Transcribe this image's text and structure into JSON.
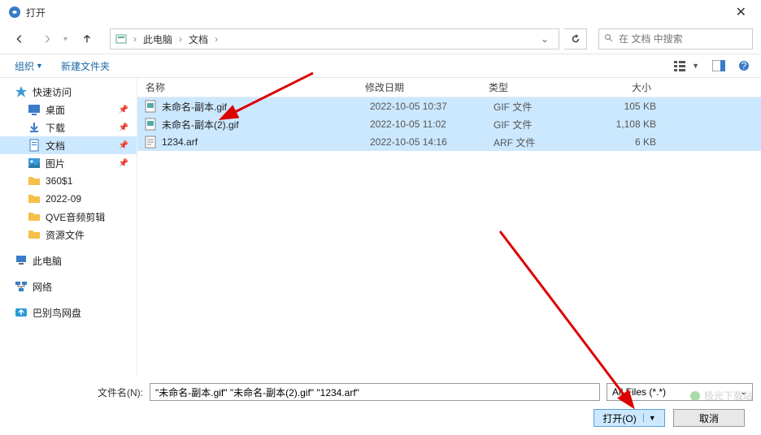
{
  "window": {
    "title": "打开"
  },
  "breadcrumbs": {
    "seg1": "此电脑",
    "seg2": "文档"
  },
  "search": {
    "placeholder": "在 文档 中搜索"
  },
  "toolbar": {
    "organize": "组织",
    "new_folder": "新建文件夹"
  },
  "sidebar": {
    "quick_access": "快速访问",
    "desktop": "桌面",
    "downloads": "下载",
    "documents": "文档",
    "pictures": "图片",
    "f1": "360$1",
    "f2": "2022-09",
    "f3": "QVE音频剪辑",
    "f4": "资源文件",
    "this_pc": "此电脑",
    "network": "网络",
    "babel": "巴别鸟网盘"
  },
  "columns": {
    "name": "名称",
    "date": "修改日期",
    "type": "类型",
    "size": "大小"
  },
  "files": [
    {
      "name": "未命名-副本.gif",
      "date": "2022-10-05 10:37",
      "type": "GIF 文件",
      "size": "105 KB"
    },
    {
      "name": "未命名-副本(2).gif",
      "date": "2022-10-05 11:02",
      "type": "GIF 文件",
      "size": "1,108 KB"
    },
    {
      "name": "1234.arf",
      "date": "2022-10-05 14:16",
      "type": "ARF 文件",
      "size": "6 KB"
    }
  ],
  "footer": {
    "filename_label": "文件名(N):",
    "filename_value": "\"未命名-副本.gif\" \"未命名-副本(2).gif\" \"1234.arf\"",
    "filter": "All Files (*.*)",
    "open": "打开(O)",
    "cancel": "取消"
  },
  "watermark": "极光下载站"
}
